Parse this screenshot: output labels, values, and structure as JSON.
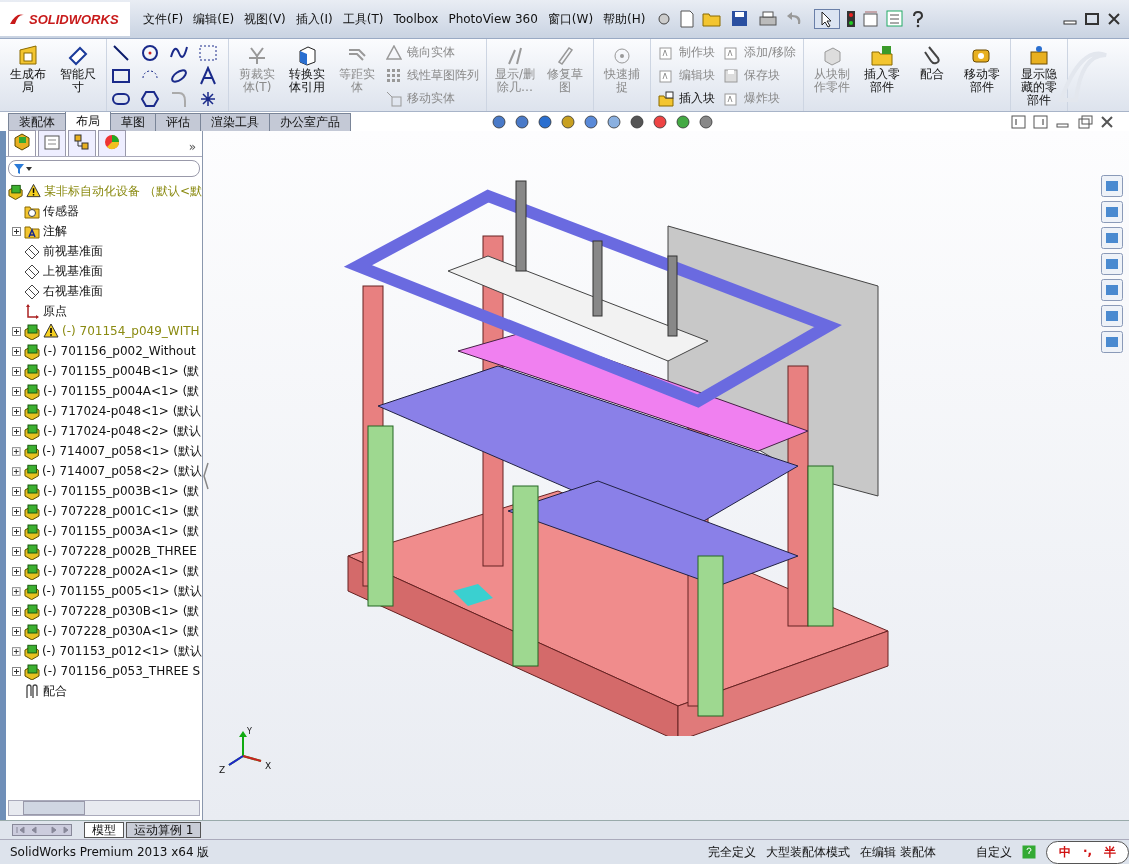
{
  "app": {
    "logo": "SOLIDWORKS"
  },
  "menu": [
    "文件(F)",
    "编辑(E)",
    "视图(V)",
    "插入(I)",
    "工具(T)",
    "Toolbox",
    "PhotoView 360",
    "窗口(W)",
    "帮助(H)"
  ],
  "ribbon": [
    {
      "items": [
        {
          "kind": "large",
          "label": "生成布局",
          "disabled": false
        },
        {
          "kind": "large",
          "label": "智能尺寸",
          "disabled": false
        }
      ]
    },
    {
      "items": [
        {
          "kind": "sketchgrid"
        }
      ]
    },
    {
      "items": [
        {
          "kind": "large",
          "label": "剪裁实体(T)",
          "disabled": true
        },
        {
          "kind": "large",
          "label": "转换实体引用",
          "disabled": false
        },
        {
          "kind": "large",
          "label": "等距实体",
          "disabled": true
        },
        {
          "kind": "small",
          "label": "镜向实体",
          "disabled": true
        },
        {
          "kind": "small",
          "label": "线性草图阵列",
          "disabled": true
        },
        {
          "kind": "small",
          "label": "移动实体",
          "disabled": true
        }
      ]
    },
    {
      "items": [
        {
          "kind": "large",
          "label": "显示/删除几…",
          "disabled": true
        },
        {
          "kind": "large",
          "label": "修复草图",
          "disabled": true
        }
      ]
    },
    {
      "items": [
        {
          "kind": "large",
          "label": "快速捕捉",
          "disabled": true
        }
      ]
    },
    {
      "items": [
        {
          "kind": "small",
          "label": "制作块",
          "disabled": true
        },
        {
          "kind": "small",
          "label": "编辑块",
          "disabled": true
        },
        {
          "kind": "small",
          "label": "插入块",
          "disabled": false
        },
        {
          "kind": "small",
          "label": "添加/移除",
          "disabled": true
        },
        {
          "kind": "small",
          "label": "保存块",
          "disabled": true
        },
        {
          "kind": "small",
          "label": "爆炸块",
          "disabled": true
        }
      ]
    },
    {
      "items": [
        {
          "kind": "large",
          "label": "从块制作零件",
          "disabled": true
        },
        {
          "kind": "large",
          "label": "插入零部件",
          "disabled": false
        },
        {
          "kind": "large",
          "label": "配合",
          "disabled": false
        },
        {
          "kind": "large",
          "label": "移动零部件",
          "disabled": false
        }
      ]
    },
    {
      "items": [
        {
          "kind": "large",
          "label": "显示隐藏的零部件",
          "disabled": false
        }
      ]
    }
  ],
  "tabs": [
    {
      "label": "装配体",
      "selected": false
    },
    {
      "label": "布局",
      "selected": true
    },
    {
      "label": "草图",
      "selected": false
    },
    {
      "label": "评估",
      "selected": false
    },
    {
      "label": "渲染工具",
      "selected": false
    },
    {
      "label": "办公室产品",
      "selected": false
    }
  ],
  "tree": {
    "expand_label": "»",
    "items": [
      {
        "kind": "assembly",
        "label": "某非标自动化设备 （默认<默",
        "warning": true,
        "collapsible": false,
        "children": [
          {
            "kind": "sensor",
            "label": "传感器",
            "warning": false,
            "collapsible": false
          },
          {
            "kind": "annotation",
            "label": "注解",
            "warning": false,
            "collapsible": true
          },
          {
            "kind": "plane",
            "label": "前视基准面",
            "warning": false,
            "collapsible": false
          },
          {
            "kind": "plane",
            "label": "上视基准面",
            "warning": false,
            "collapsible": false
          },
          {
            "kind": "plane",
            "label": "右视基准面",
            "warning": false,
            "collapsible": false
          },
          {
            "kind": "origin",
            "label": "原点",
            "warning": false,
            "collapsible": false
          },
          {
            "kind": "part",
            "label": "(-) 701154_p049_WITH",
            "warning": true,
            "collapsible": true
          },
          {
            "kind": "part",
            "label": "(-) 701156_p002_Without",
            "warning": false,
            "collapsible": true
          },
          {
            "kind": "part",
            "label": "(-) 701155_p004B<1> (默",
            "warning": false,
            "collapsible": true
          },
          {
            "kind": "part",
            "label": "(-) 701155_p004A<1> (默",
            "warning": false,
            "collapsible": true
          },
          {
            "kind": "part",
            "label": "(-) 717024-p048<1> (默认",
            "warning": false,
            "collapsible": true
          },
          {
            "kind": "part",
            "label": "(-) 717024-p048<2> (默认",
            "warning": false,
            "collapsible": true
          },
          {
            "kind": "part",
            "label": "(-) 714007_p058<1> (默认",
            "warning": false,
            "collapsible": true
          },
          {
            "kind": "part",
            "label": "(-) 714007_p058<2> (默认",
            "warning": false,
            "collapsible": true
          },
          {
            "kind": "part",
            "label": "(-) 701155_p003B<1> (默",
            "warning": false,
            "collapsible": true
          },
          {
            "kind": "part",
            "label": "(-) 707228_p001C<1> (默",
            "warning": false,
            "collapsible": true
          },
          {
            "kind": "part",
            "label": "(-) 701155_p003A<1> (默",
            "warning": false,
            "collapsible": true
          },
          {
            "kind": "part",
            "label": "(-) 707228_p002B_THREE",
            "warning": false,
            "collapsible": true
          },
          {
            "kind": "part",
            "label": "(-) 707228_p002A<1> (默",
            "warning": false,
            "collapsible": true
          },
          {
            "kind": "part",
            "label": "(-) 701155_p005<1> (默认",
            "warning": false,
            "collapsible": true
          },
          {
            "kind": "part",
            "label": "(-) 707228_p030B<1> (默",
            "warning": false,
            "collapsible": true
          },
          {
            "kind": "part",
            "label": "(-) 707228_p030A<1> (默",
            "warning": false,
            "collapsible": true
          },
          {
            "kind": "part",
            "label": "(-) 701153_p012<1> (默认",
            "warning": false,
            "collapsible": true
          },
          {
            "kind": "part",
            "label": "(-) 701156_p053_THREE S",
            "warning": false,
            "collapsible": true
          },
          {
            "kind": "mates",
            "label": "配合",
            "warning": false,
            "collapsible": false
          }
        ]
      }
    ]
  },
  "triad": {
    "x": "X",
    "y": "Y",
    "z": "Z"
  },
  "bottom_tabs": [
    {
      "label": "模型",
      "selected": true
    },
    {
      "label": "运动算例 1",
      "selected": false
    }
  ],
  "status_bar": {
    "product": "SolidWorks Premium 2013 x64 版",
    "fields": [
      "完全定义",
      "大型装配体模式",
      "在编辑 装配体"
    ],
    "units": "自定义",
    "ime": [
      "中",
      "·,",
      "半"
    ]
  }
}
